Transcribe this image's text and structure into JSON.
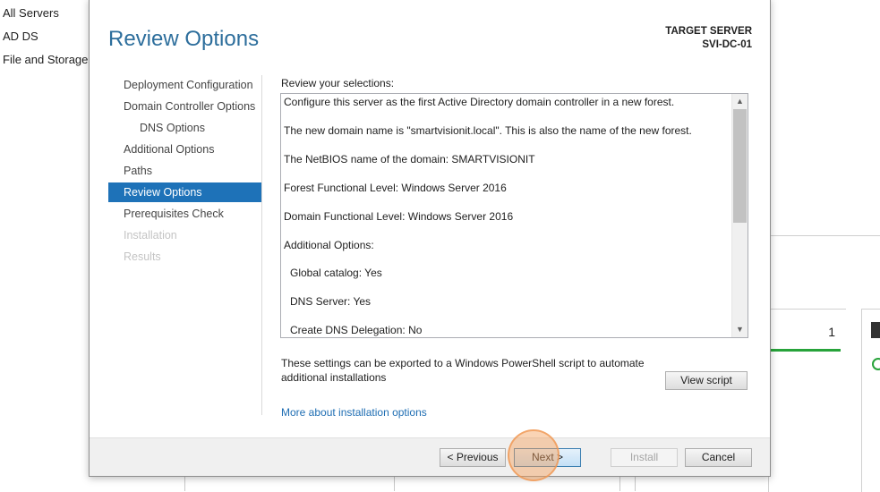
{
  "background": {
    "nav_items": [
      "All Servers",
      "AD DS",
      "File and Storage"
    ],
    "tile_count": "1",
    "colors": {
      "status_ok": "#27a33a"
    }
  },
  "dialog": {
    "title": "Review Options",
    "target_server_label": "TARGET SERVER",
    "target_server_name": "SVI-DC-01",
    "nav": [
      {
        "label": "Deployment Configuration",
        "state": "normal"
      },
      {
        "label": "Domain Controller Options",
        "state": "normal"
      },
      {
        "label": "DNS Options",
        "state": "sub"
      },
      {
        "label": "Additional Options",
        "state": "normal"
      },
      {
        "label": "Paths",
        "state": "normal"
      },
      {
        "label": "Review Options",
        "state": "active"
      },
      {
        "label": "Prerequisites Check",
        "state": "normal"
      },
      {
        "label": "Installation",
        "state": "disabled"
      },
      {
        "label": "Results",
        "state": "disabled"
      }
    ],
    "review_label": "Review your selections:",
    "review_lines": [
      "Configure this server as the first Active Directory domain controller in a new forest.",
      "The new domain name is \"smartvisionit.local\". This is also the name of the new forest.",
      "The NetBIOS name of the domain: SMARTVISIONIT",
      "Forest Functional Level: Windows Server 2016",
      "Domain Functional Level: Windows Server 2016",
      "Additional Options:",
      "Global catalog: Yes",
      "DNS Server: Yes",
      "Create DNS Delegation: No"
    ],
    "export_text": "These settings can be exported to a Windows PowerShell script to automate additional installations",
    "view_script_label": "View script",
    "more_link": "More about installation options",
    "buttons": {
      "previous": "< Previous",
      "next": "Next >",
      "install": "Install",
      "cancel": "Cancel"
    },
    "colors": {
      "title": "#2d6e9c",
      "nav_active": "#1e72b8",
      "link": "#1f6eb3"
    }
  }
}
